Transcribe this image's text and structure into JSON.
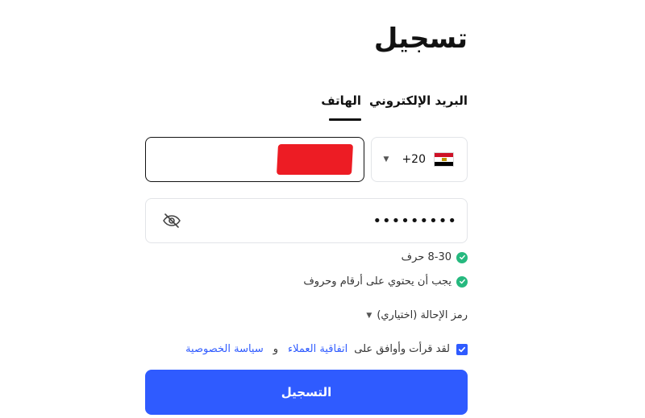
{
  "page": {
    "title": "تسجيل"
  },
  "tabs": [
    {
      "label": "البريد الإلكتروني",
      "active": false
    },
    {
      "label": "الهاتف",
      "active": true
    }
  ],
  "phone": {
    "country_flag": "egypt-flag-icon",
    "dial_code": "+20",
    "value": "",
    "redacted": true
  },
  "password": {
    "value": "•••••••••",
    "visibility_icon": "eye-off-icon"
  },
  "rules": [
    {
      "text": "8-30 حرف",
      "status": "ok"
    },
    {
      "text": "يجب أن يحتوي على أرقام وحروف",
      "status": "ok"
    }
  ],
  "referral": {
    "label": "رمز الإحالة (اختياري)"
  },
  "agreement": {
    "prefix": "لقد قرأت وأوافق على",
    "terms_link": "اتفاقية العملاء",
    "and": "و",
    "privacy_link": "سياسة الخصوصية",
    "checked": true
  },
  "submit": {
    "label": "التسجيل"
  },
  "colors": {
    "accent": "#2f5bff",
    "success": "#26b97f",
    "text": "#121212",
    "border": "#e2e4e8"
  }
}
